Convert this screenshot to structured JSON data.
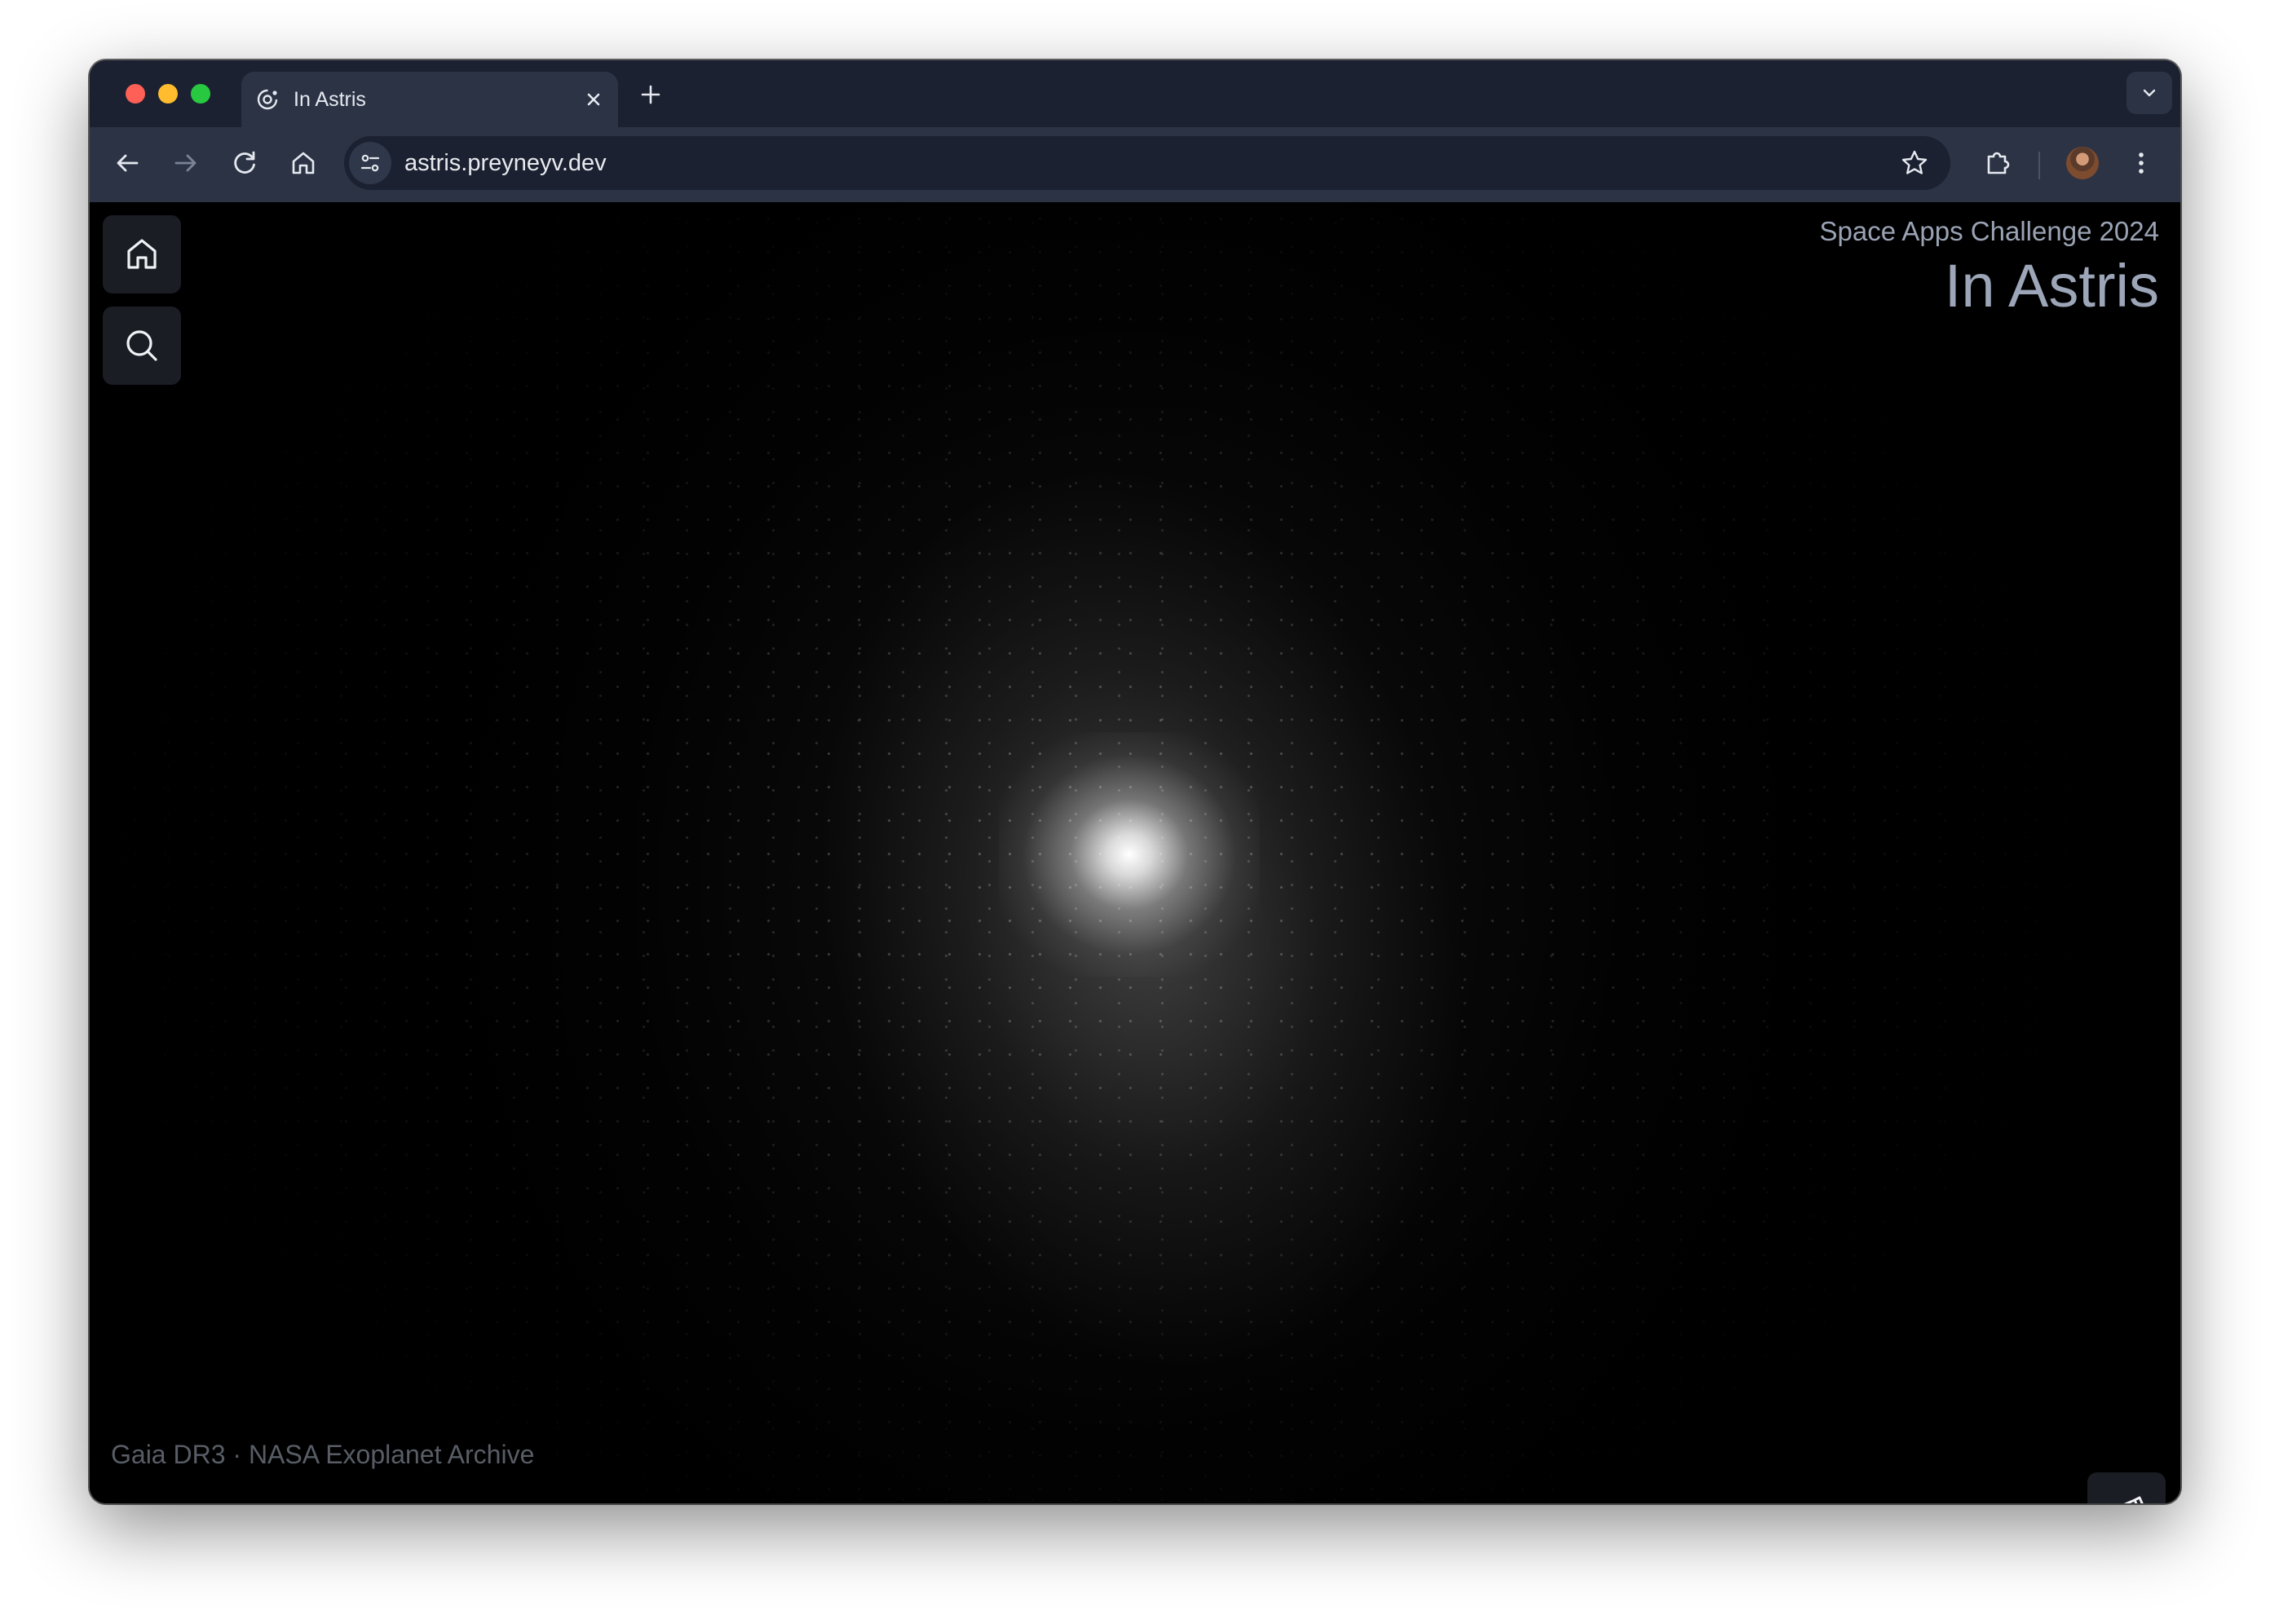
{
  "browser": {
    "tab": {
      "title": "In Astris",
      "favicon": "orbit-icon"
    },
    "url": "astris.preyneyv.dev"
  },
  "page": {
    "subtitle": "Space Apps Challenge 2024",
    "title": "In Astris",
    "credit": "Gaia DR3 · NASA Exoplanet Archive",
    "nav": [
      {
        "name": "home",
        "icon": "home-icon"
      },
      {
        "name": "search",
        "icon": "search-icon"
      }
    ],
    "action_icon": "telescope-icon"
  },
  "colors": {
    "tab_strip": "#1b2130",
    "toolbar": "#2b3345",
    "sky": "#000000",
    "title_text": "#9ca6b8",
    "credit_text": "#585d66"
  }
}
